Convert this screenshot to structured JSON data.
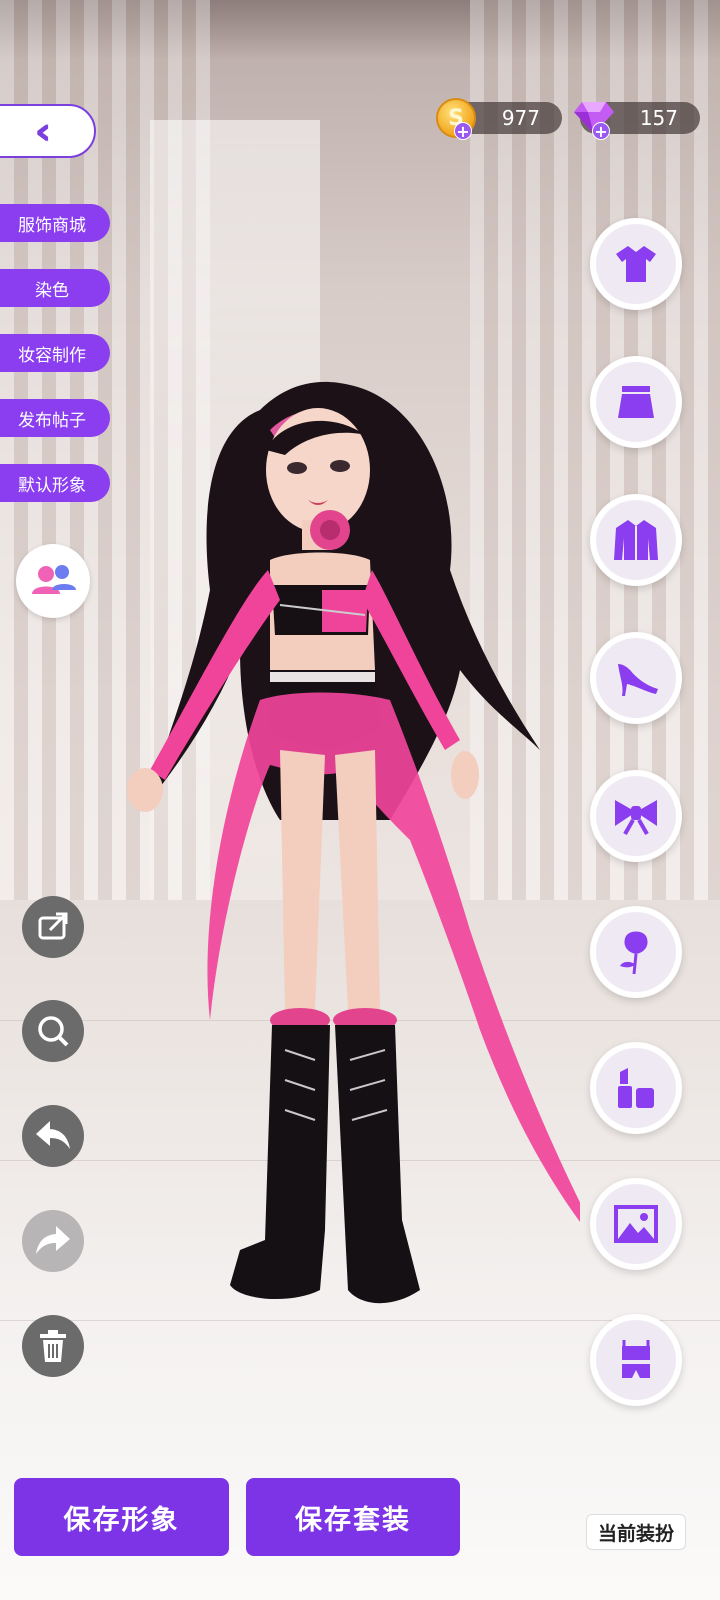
{
  "header": {
    "back_icon": "double-chevron-left-icon",
    "coins": "977",
    "gems": "157",
    "coin_symbol": "S",
    "plus": "+"
  },
  "left_menu": [
    {
      "label": "服饰商城"
    },
    {
      "label": "染色"
    },
    {
      "label": "妆容制作"
    },
    {
      "label": "发布帖子"
    },
    {
      "label": "默认形象"
    }
  ],
  "tools": [
    "share-icon",
    "zoom-icon",
    "undo-icon",
    "redo-icon",
    "trash-icon"
  ],
  "categories": [
    "top-icon",
    "skirt-icon",
    "jacket-icon",
    "high-heel-icon",
    "bow-icon",
    "rose-icon",
    "makeup-icon",
    "background-icon",
    "outfit-set-icon"
  ],
  "bottom": {
    "save_look": "保存形象",
    "save_outfit": "保存套装",
    "current_outfit": "当前装扮"
  },
  "colors": {
    "accent": "#7c34e6",
    "icon": "#8a3ef0",
    "outfit_pink": "#f0449a"
  }
}
